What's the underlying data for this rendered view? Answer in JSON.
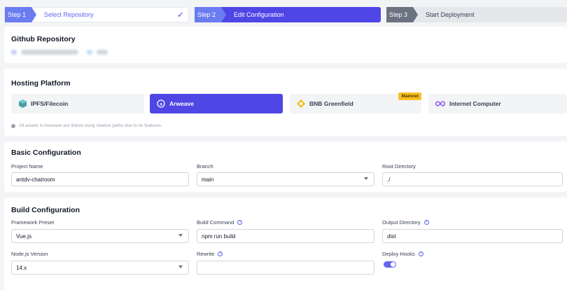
{
  "steps": [
    {
      "num": "Step 1",
      "label": "Select Repository"
    },
    {
      "num": "Step 2",
      "label": "Edit Configuration"
    },
    {
      "num": "Step 3",
      "label": "Start Deployment"
    }
  ],
  "repo": {
    "title": "Github Repository"
  },
  "hosting": {
    "title": "Hosting Platform",
    "platforms": [
      "IPFS/Filecoin",
      "Arweave",
      "BNB Greenfield",
      "Internet Computer"
    ],
    "badge": "Mainnet",
    "hint": "All assets in Arweave are linked using relative paths due to its features."
  },
  "basic": {
    "title": "Basic Configuration",
    "project_label": "Project Name",
    "project_value": "antdv-chatroom",
    "branch_label": "Branch",
    "branch_value": "main",
    "root_label": "Root Directory",
    "root_value": "./"
  },
  "build": {
    "title": "Build Configuration",
    "preset_label": "Framework Preset",
    "preset_value": "Vue.js",
    "command_label": "Build Command",
    "command_value": "npm run build",
    "output_label": "Output Directory",
    "output_value": "dist",
    "node_label": "Node.js Version",
    "node_value": "14.x",
    "rewrite_label": "Rewrite",
    "rewrite_value": "",
    "hooks_label": "Deploy Hooks",
    "hooks_enabled": true
  },
  "colors": {
    "primary": "#4f46e5",
    "badge": "#fbbf24"
  }
}
